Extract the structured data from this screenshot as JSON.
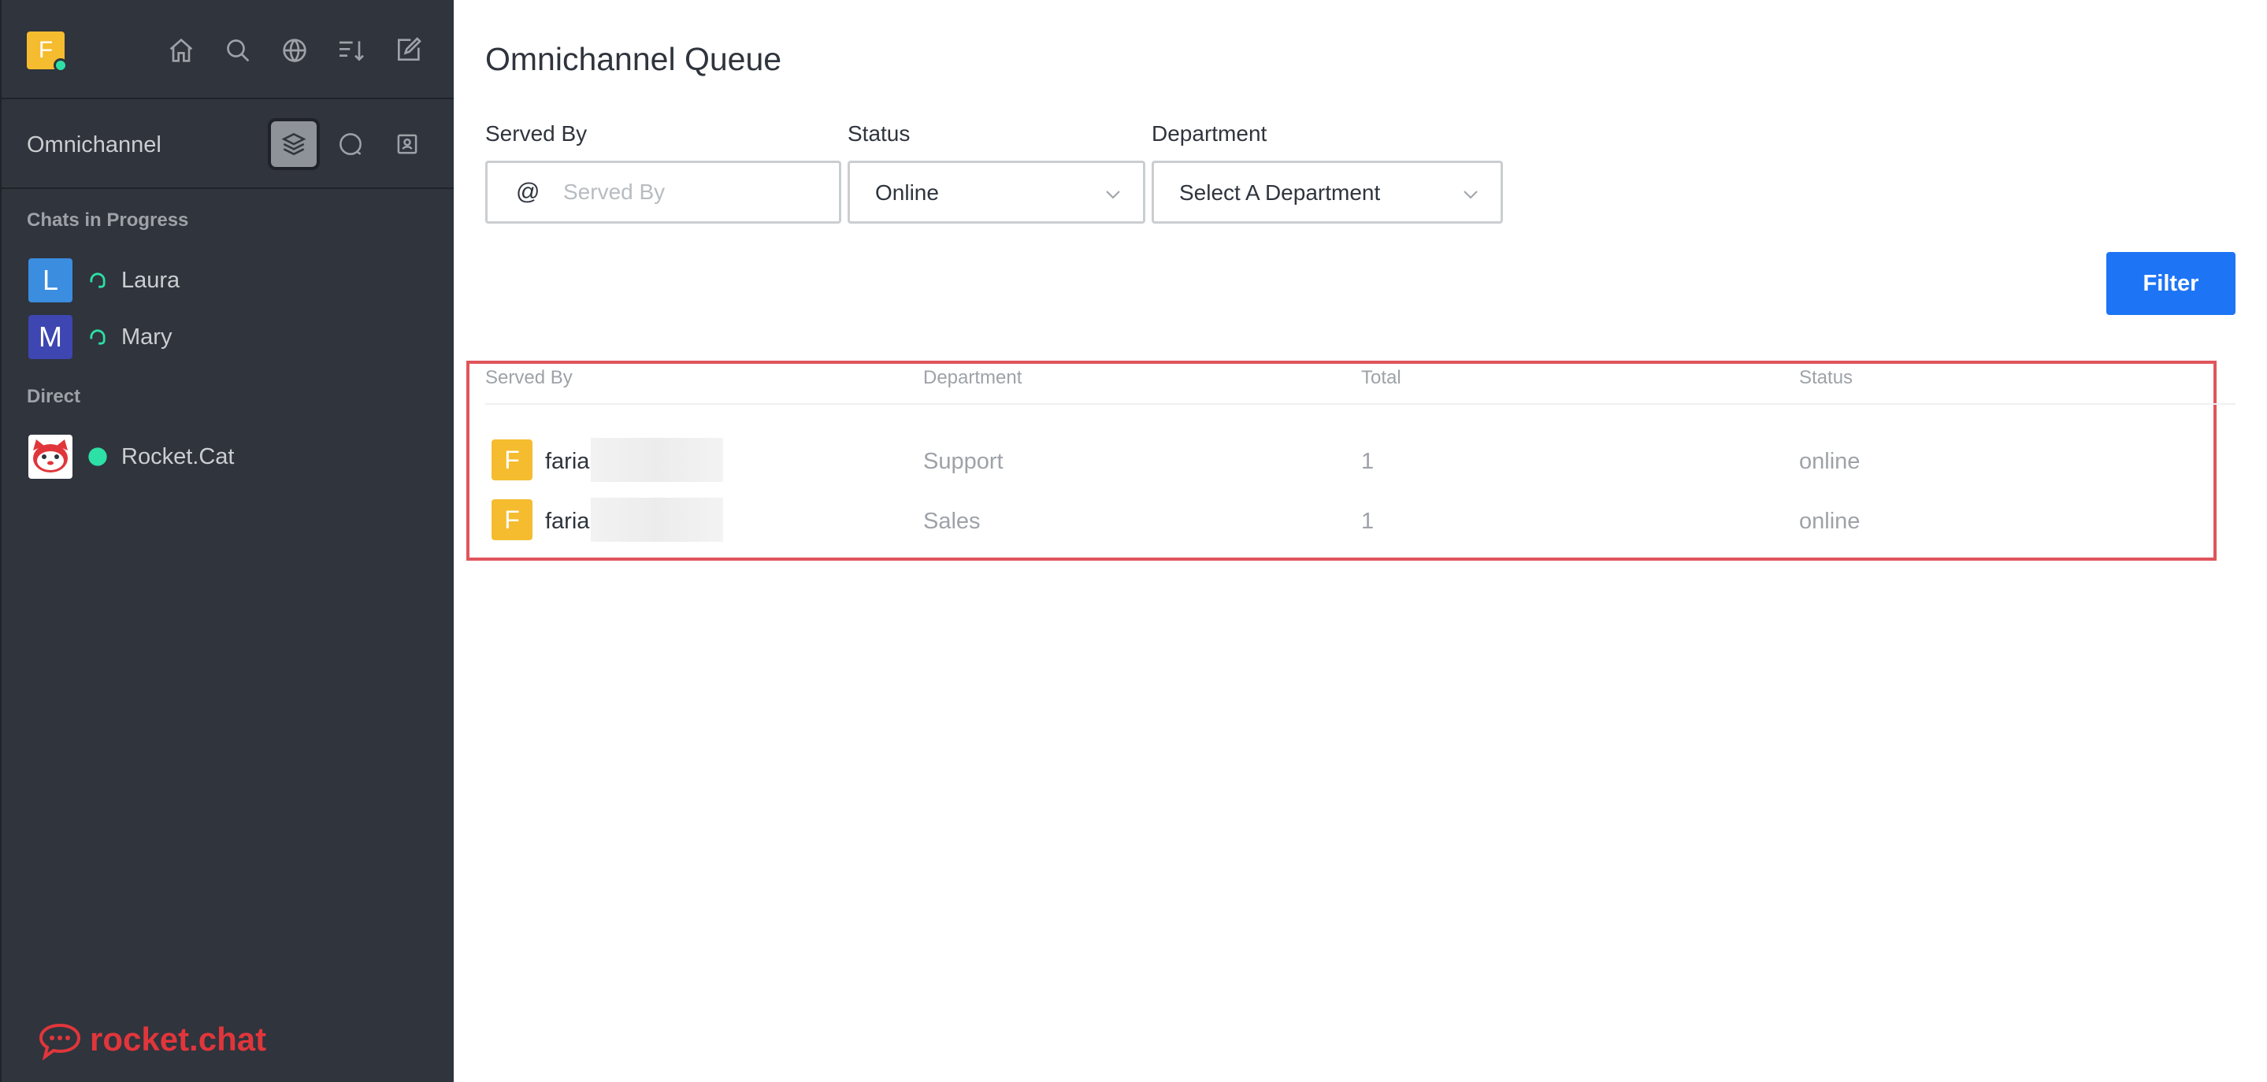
{
  "user": {
    "avatar_letter": "F",
    "status_color": "#2de0a5",
    "avatar_color": "#f5bc2f"
  },
  "topbar_icons": [
    "home-icon",
    "search-icon",
    "globe-icon",
    "sort-icon",
    "edit-icon"
  ],
  "omnichannel": {
    "label": "Omnichannel",
    "icons": [
      "queue-icon",
      "chat-icon",
      "contact-icon"
    ]
  },
  "sections": {
    "in_progress": "Chats in Progress",
    "direct": "Direct"
  },
  "rooms_in_progress": [
    {
      "letter": "L",
      "name": "Laura",
      "color": "#3b8de0"
    },
    {
      "letter": "M",
      "name": "Mary",
      "color": "#3d46b1"
    }
  ],
  "rooms_direct": [
    {
      "name": "Rocket.Cat"
    }
  ],
  "logo": {
    "text": "rocket.chat",
    "color": "#e0363b"
  },
  "page": {
    "title": "Omnichannel Queue",
    "served_by_label": "Served By",
    "served_by_placeholder": "Served By",
    "served_by_prefix": "@",
    "status_label": "Status",
    "status_value": "Online",
    "department_label": "Department",
    "department_value": "Select A Department",
    "filter_button": "Filter"
  },
  "table": {
    "headers": [
      "Served By",
      "Department",
      "Total",
      "Status"
    ],
    "rows": [
      {
        "letter": "F",
        "served_by": "faria",
        "department": "Support",
        "total": "1",
        "status": "online"
      },
      {
        "letter": "F",
        "served_by": "faria",
        "department": "Sales",
        "total": "1",
        "status": "online"
      }
    ]
  },
  "colors": {
    "primary": "#1d74f5",
    "sidebar": "#2f343d",
    "highlight": "#e0555b"
  }
}
